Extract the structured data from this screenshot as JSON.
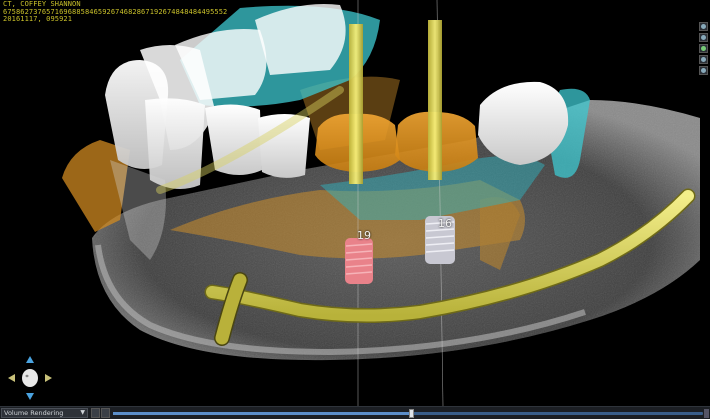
{
  "header": {
    "patient": "CT, COFFEY SHANNON",
    "uid": "6758627376571696885846592674682867192674848484495552",
    "timestamp": "20161117, 095921"
  },
  "implants": [
    {
      "label": "19",
      "color": "#e9828a"
    },
    {
      "label": "16",
      "color": "#c8c8d2"
    }
  ],
  "colors": {
    "bone": "#9a9a9a",
    "teeth": "#f4f4f4",
    "nerve": "#e6e05a",
    "gingiva": "#3ec8d0",
    "crown": "#f0a020"
  },
  "toolbar": {
    "icons": [
      "camera-icon",
      "settings-icon",
      "view-icon",
      "plane-icon",
      "layers-icon"
    ]
  },
  "orientation_cube": {
    "icons": [
      "arrow-up-icon",
      "arrow-down-icon",
      "arrow-left-icon",
      "arrow-right-icon",
      "head-icon"
    ]
  },
  "statusbar": {
    "mode": "Volume Rendering",
    "slider_position": 0.505
  }
}
